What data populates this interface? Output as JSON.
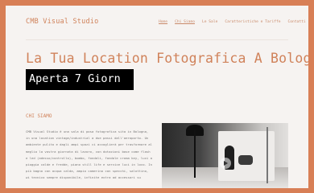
{
  "header": {
    "logo": "CMB Visual Studio",
    "nav": [
      {
        "label": "Home",
        "active": true
      },
      {
        "label": "Chi Siamo",
        "active": false
      },
      {
        "label": "Le Sale",
        "active": false
      },
      {
        "label": "Caratteristiche e Tariffe",
        "active": false
      },
      {
        "label": "Contatti",
        "active": false
      }
    ]
  },
  "hero": {
    "title": "La Tua Location Fotografica A Bologna",
    "highlight": "Aperta 7 Giorn"
  },
  "about": {
    "title": "CHI SIAMO",
    "lines": [
      "CMB Visual Studio è una  sala di posa fotografica sita in Bologna,",
      "in una location vintage/industrial a due passi dall'aeroporto. Un",
      "ambiente pulito e dagli ampi spazi ci accoglierà per trasformare al",
      "meglio la vostra giornata di lavoro, con dotazioni base come  flash",
      "e led (adesso/controllo), bombo, fondali, fondale  croma key, luci a",
      "pioggia calde e fredde, piano still life e service luci in loco. In",
      "più bagno con acqua calda, ampio camerino con specchi, salottino,",
      "wi   tecnico sempre disponibile, infinite extra ad accessori su"
    ]
  },
  "video": {
    "play_icon": "play-icon"
  },
  "colors": {
    "accent": "#d0825a",
    "border": "#d87f56",
    "background": "#f6f3f1"
  }
}
